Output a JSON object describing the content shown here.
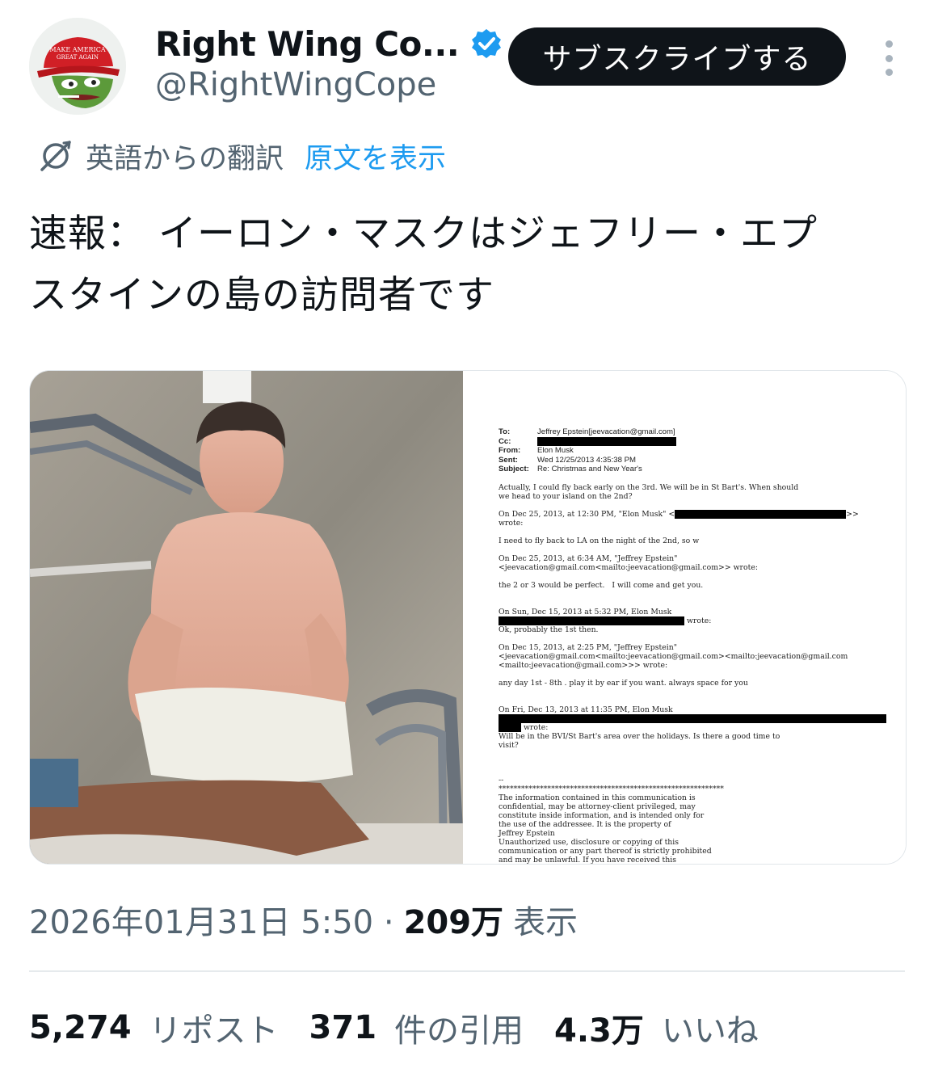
{
  "author": {
    "display_name": "Right Wing Co...",
    "handle": "@RightWingCope",
    "verified_icon": "verified-badge-icon",
    "avatar_cap_text": [
      "MAKE AMERICA",
      "GREAT AGAIN"
    ]
  },
  "actions": {
    "subscribe_label": "サブスクライブする",
    "more_icon": "more-vertical-icon"
  },
  "translation": {
    "icon": "translate-icon",
    "label": "英語からの翻訳",
    "show_original": "原文を表示"
  },
  "tweet": {
    "text_line1": "速報：  イーロン・マスクはジェフリー・エプ",
    "text_line2": "スタインの島の訪問者です"
  },
  "document": {
    "header": [
      {
        "key": "To:",
        "value": "Jeffrey Epstein[jeevacation@gmail.com]"
      },
      {
        "key": "Cc:",
        "value": ""
      },
      {
        "key": "From:",
        "value": "Elon Musk"
      },
      {
        "key": "Sent:",
        "value": "Wed 12/25/2013 4:35:38 PM"
      },
      {
        "key": "Subject:",
        "value": "Re: Christmas and New Year's"
      }
    ],
    "p1": "Actually, I could fly back early on the 3rd. We will be in St Bart's. When should\nwe head to your island on the 2nd?",
    "p2a": "On Dec 25, 2013, at 12:30 PM, \"Elon Musk\" <",
    "p2b": ">>",
    "p2c": "wrote:",
    "p3": "I need to fly back to LA on the night of the 2nd, so w",
    "p4": "On Dec 25, 2013, at 6:34 AM, \"Jeffrey Epstein\"\n<jeevacation@gmail.com<mailto:jeevacation@gmail.com>> wrote:",
    "p5": "the 2 or 3 would be perfect.   I will come and get you.",
    "p6": "On Sun, Dec 15, 2013 at 5:32 PM, Elon Musk",
    "p6b": "wrote:",
    "p6c": "Ok, probably the 1st then.",
    "p7": "On Dec 15, 2013, at 2:25 PM, \"Jeffrey Epstein\"\n<jeevacation@gmail.com<mailto:jeevacation@gmail.com><mailto:jeevacation@gmail.com\n<mailto:jeevacation@gmail.com>>> wrote:",
    "p8": "any day 1st - 8th . play it by ear if you want. always space for you",
    "p9": "On Fri, Dec 13, 2013 at 11:35 PM, Elon Musk",
    "p9b": "wrote:",
    "p9c": "Will be in the BVI/St Bart's area over the holidays. Is there a good time to\nvisit?",
    "p10": "--\n************************************************************\nThe information contained in this communication is\nconfidential, may be attorney-client privileged, may\nconstitute inside information, and is intended only for\nthe use of the addressee. It is the property of\nJeffrey Epstein\nUnauthorized use, disclosure or copying of this\ncommunication or any part thereof is strictly prohibited\nand may be unlawful. If you have received this"
  },
  "meta": {
    "timestamp": "2026年01月31日 5:50 ·",
    "views": "209万",
    "views_label": "表示"
  },
  "stats": [
    {
      "num": "5,274",
      "label": "リポスト"
    },
    {
      "num": "371",
      "label": "件の引用"
    },
    {
      "num": "4.3万",
      "label": "いいね"
    }
  ],
  "colors": {
    "accent": "#1d9bf0",
    "text_primary": "#0f1419",
    "text_secondary": "#536471",
    "button_bg": "#0f1419"
  }
}
